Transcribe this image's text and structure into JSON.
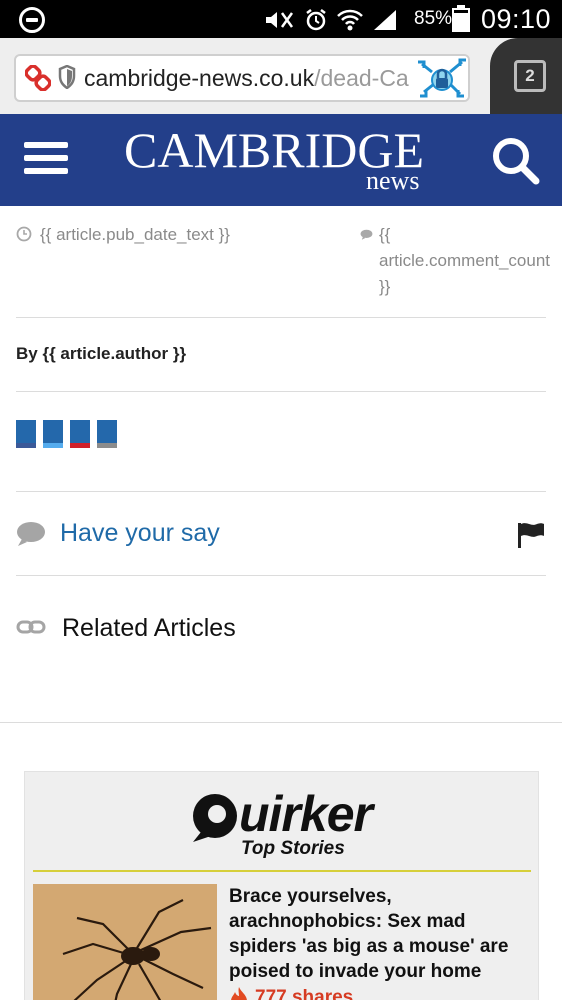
{
  "status_bar": {
    "battery_percent": "85%",
    "battery_level": 0.85,
    "time": "09:10"
  },
  "browser": {
    "url_domain": "cambridge-news.co.uk",
    "url_path": "/dead-Ca",
    "tab_count": "2"
  },
  "header": {
    "logo_main": "CAMBRIDGE",
    "logo_sub": "news",
    "brand_color": "#233f8a"
  },
  "article": {
    "pub_date": "{{ article.pub_date_text }}",
    "comment_count": "{{ article.comment_count }}",
    "byline": "By {{ article.author }}"
  },
  "share_buttons": [
    {
      "name": "share-facebook",
      "accent": "#3b5998"
    },
    {
      "name": "share-twitter",
      "accent": "#55acee"
    },
    {
      "name": "share-google",
      "accent": "#d0202a"
    },
    {
      "name": "share-email",
      "accent": "#8c8c8c"
    }
  ],
  "actions": {
    "have_your_say": "Have your say",
    "related_articles": "Related Articles"
  },
  "quirker": {
    "brand": "uirker",
    "section": "Top Stories",
    "story": {
      "headline": "Brace yourselves, arachnophobics: Sex mad spiders 'as big as a mouse' are poised to invade your home",
      "shares": "777 shares"
    }
  }
}
